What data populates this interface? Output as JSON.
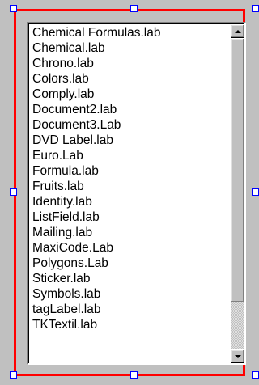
{
  "listbox": {
    "items": [
      "Chemical Formulas.lab",
      "Chemical.lab",
      "Chrono.lab",
      "Colors.lab",
      "Comply.lab",
      "Document2.lab",
      "Document3.Lab",
      "DVD Label.lab",
      "Euro.Lab",
      "Formula.lab",
      "Fruits.lab",
      "Identity.lab",
      "ListField.lab",
      "Mailing.lab",
      "MaxiCode.Lab",
      "Polygons.Lab",
      "Sticker.lab",
      "Symbols.lab",
      "tagLabel.lab",
      "TKTextil.lab"
    ],
    "scroll_position": 0,
    "visible_fraction": 0.85
  },
  "selection": {
    "frame_color": "#ff0000",
    "handle_border_color": "#0000ff",
    "handle_fill_color": "#ffffff"
  },
  "icons": {
    "scroll_up": "triangle-up-icon",
    "scroll_down": "triangle-down-icon"
  }
}
